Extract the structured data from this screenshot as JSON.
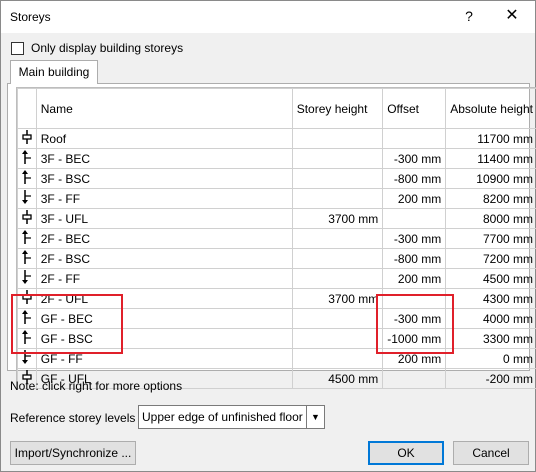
{
  "window": {
    "title": "Storeys",
    "help_label": "?",
    "close_label": "✕"
  },
  "filter": {
    "label": "Only display building storeys",
    "checked": false
  },
  "tabs": [
    {
      "label": "Main building",
      "active": true
    }
  ],
  "table": {
    "columns": [
      "",
      "Name",
      "Storey height",
      "Offset",
      "Absolute height"
    ],
    "rows": [
      {
        "glyph": "storey",
        "name": "Roof",
        "storey_height": "",
        "offset": "",
        "absolute": "11700 mm"
      },
      {
        "glyph": "up",
        "name": "3F - BEC",
        "storey_height": "",
        "offset": "-300 mm",
        "absolute": "11400 mm"
      },
      {
        "glyph": "up",
        "name": "3F - BSC",
        "storey_height": "",
        "offset": "-800 mm",
        "absolute": "10900 mm"
      },
      {
        "glyph": "down",
        "name": "3F - FF",
        "storey_height": "",
        "offset": "200 mm",
        "absolute": "8200 mm"
      },
      {
        "glyph": "storey",
        "name": "3F - UFL",
        "storey_height": "3700 mm",
        "offset": "",
        "absolute": "8000 mm"
      },
      {
        "glyph": "up",
        "name": "2F - BEC",
        "storey_height": "",
        "offset": "-300 mm",
        "absolute": "7700 mm"
      },
      {
        "glyph": "up",
        "name": "2F - BSC",
        "storey_height": "",
        "offset": "-800 mm",
        "absolute": "7200 mm"
      },
      {
        "glyph": "down",
        "name": "2F - FF",
        "storey_height": "",
        "offset": "200 mm",
        "absolute": "4500 mm"
      },
      {
        "glyph": "storey",
        "name": "2F - UFL",
        "storey_height": "3700 mm",
        "offset": "",
        "absolute": "4300 mm"
      },
      {
        "glyph": "up",
        "name": "GF - BEC",
        "storey_height": "",
        "offset": "-300 mm",
        "absolute": "4000 mm"
      },
      {
        "glyph": "up",
        "name": "GF - BSC",
        "storey_height": "",
        "offset": "-1000 mm",
        "absolute": "3300 mm"
      },
      {
        "glyph": "down",
        "name": "GF - FF",
        "storey_height": "",
        "offset": "200 mm",
        "absolute": "0 mm"
      },
      {
        "glyph": "storey",
        "name": "GF - UFL",
        "storey_height": "4500 mm",
        "offset": "",
        "absolute": "-200 mm"
      }
    ]
  },
  "note": "Note: click right for more options",
  "reference": {
    "label": "Reference storey levels",
    "value": "Upper edge of unfinished floor"
  },
  "buttons": {
    "import": "Import/Synchronize ...",
    "ok": "OK",
    "cancel": "Cancel"
  },
  "annotation_color": "#e0202a",
  "accent_color": "#0078d7"
}
